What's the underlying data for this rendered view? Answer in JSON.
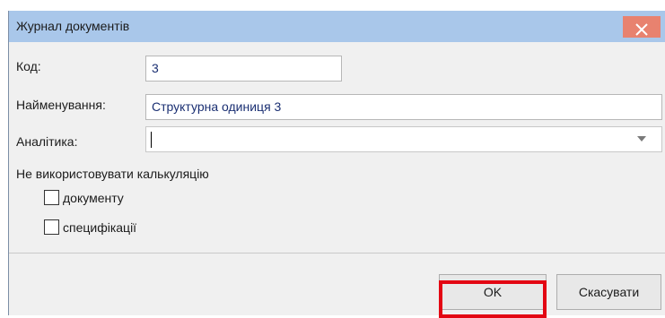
{
  "window": {
    "title": "Журнал документів"
  },
  "form": {
    "code": {
      "label": "Код:",
      "value": "3"
    },
    "name": {
      "label": "Найменування:",
      "value": "Структурна одиниця 3"
    },
    "analytics": {
      "label": "Аналітика:",
      "value": ""
    }
  },
  "calculation": {
    "heading": "Не використовувати калькуляцію",
    "options": [
      {
        "label": "документу",
        "checked": false
      },
      {
        "label": "специфікації",
        "checked": false
      }
    ]
  },
  "buttons": {
    "ok": "OK",
    "cancel": "Скасувати"
  },
  "icons": {
    "close": "close-icon",
    "dropdown": "chevron-down-icon"
  },
  "colors": {
    "titlebar": "#a9c7ea",
    "close_button": "#e8826f",
    "highlight": "#e30613"
  }
}
